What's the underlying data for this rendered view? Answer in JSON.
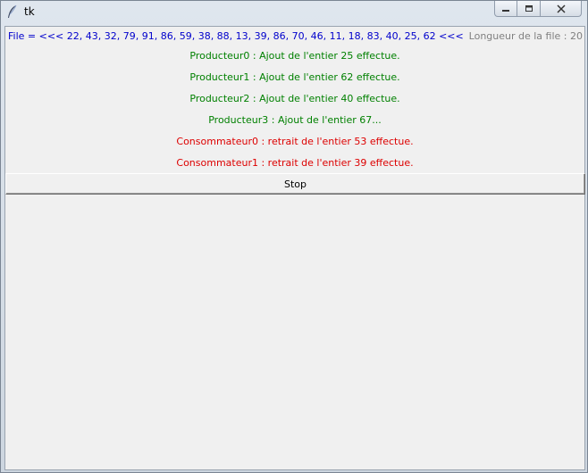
{
  "window": {
    "title": "tk"
  },
  "queue": {
    "text": "File = <<< 22, 43, 32, 79, 91, 86, 59, 38, 88, 13, 39, 86, 70, 46, 11, 18, 83, 40, 25, 62 <<<",
    "length_label": "Longueur de la file : 20"
  },
  "messages": [
    {
      "text": "Producteur0 : Ajout de l'entier 25 effectue.",
      "color": "#008000"
    },
    {
      "text": "Producteur1 : Ajout de l'entier 62 effectue.",
      "color": "#008000"
    },
    {
      "text": "Producteur2 : Ajout de l'entier 40 effectue.",
      "color": "#008000"
    },
    {
      "text": "Producteur3 : Ajout de l'entier 67...",
      "color": "#008000"
    },
    {
      "text": "Consommateur0 : retrait de l'entier 53 effectue.",
      "color": "#dd0000"
    },
    {
      "text": "Consommateur1 : retrait de l'entier 39 effectue.",
      "color": "#dd0000"
    }
  ],
  "controls": {
    "stop_label": "Stop"
  },
  "icons": {
    "app": "feather-icon",
    "minimize": "minimize-icon",
    "maximize": "maximize-icon",
    "close": "close-icon"
  }
}
